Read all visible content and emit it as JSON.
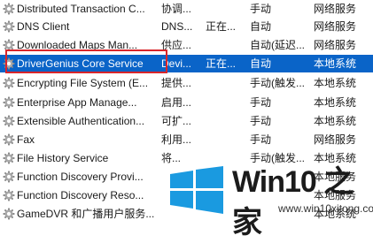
{
  "services": [
    {
      "name": "Distributed Transaction C...",
      "description": "协调...",
      "status": "",
      "startup_type": "手动",
      "log_on_as": "网络服务"
    },
    {
      "name": "DNS Client",
      "description": "DNS...",
      "status": "正在...",
      "startup_type": "自动",
      "log_on_as": "网络服务"
    },
    {
      "name": "Downloaded Maps Man...",
      "description": "供应...",
      "status": "",
      "startup_type": "自动(延迟...",
      "log_on_as": "网络服务"
    },
    {
      "name": "DriverGenius Core Service",
      "description": "Devi...",
      "status": "正在...",
      "startup_type": "自动",
      "log_on_as": "本地系统"
    },
    {
      "name": "Encrypting File System (E...",
      "description": "提供...",
      "status": "",
      "startup_type": "手动(触发...",
      "log_on_as": "本地系统"
    },
    {
      "name": "Enterprise App Manage...",
      "description": "启用...",
      "status": "",
      "startup_type": "手动",
      "log_on_as": "本地系统"
    },
    {
      "name": "Extensible Authentication...",
      "description": "可扩...",
      "status": "",
      "startup_type": "手动",
      "log_on_as": "本地系统"
    },
    {
      "name": "Fax",
      "description": "利用...",
      "status": "",
      "startup_type": "手动",
      "log_on_as": "网络服务"
    },
    {
      "name": "File History Service",
      "description": "将...",
      "status": "",
      "startup_type": "手动(触发...",
      "log_on_as": "本地系统"
    },
    {
      "name": "Function Discovery Provi...",
      "description": "",
      "status": "",
      "startup_type": "",
      "log_on_as": "本地服务"
    },
    {
      "name": "Function Discovery Reso...",
      "description": "",
      "status": "",
      "startup_type": "",
      "log_on_as": "本地服务"
    },
    {
      "name": "GameDVR 和广播用户服务...",
      "description": "",
      "status": "",
      "startup_type": "",
      "log_on_as": "本地系统"
    }
  ],
  "selected_index": 3,
  "watermark": {
    "title": "Win10 之家",
    "url": "www.win10xitong.com"
  },
  "colors": {
    "selection": "#0a64c8",
    "highlight_box": "#d9252a",
    "logo_blue": "#1a9ae0"
  },
  "icons": {
    "service": "gear-icon"
  }
}
